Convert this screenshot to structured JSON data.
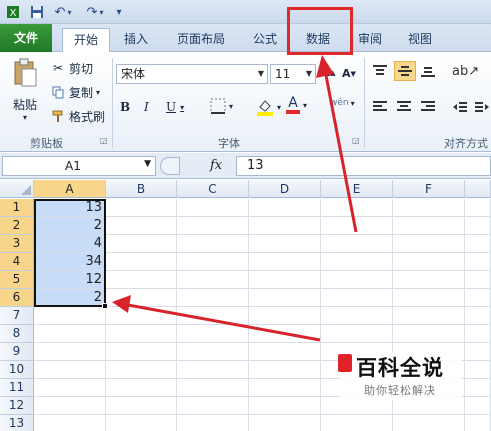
{
  "quick_access": {
    "save_icon": "save-icon",
    "undo_icon": "undo-icon",
    "redo_icon": "redo-icon"
  },
  "tabs": [
    {
      "label": "文件"
    },
    {
      "label": "开始"
    },
    {
      "label": "插入"
    },
    {
      "label": "页面布局"
    },
    {
      "label": "公式"
    },
    {
      "label": "数据"
    },
    {
      "label": "审阅"
    },
    {
      "label": "视图"
    }
  ],
  "clipboard": {
    "paste": "粘贴",
    "cut": "剪切",
    "copy": "复制",
    "format_painter": "格式刷",
    "group": "剪贴板"
  },
  "font": {
    "name": "宋体",
    "size": "11",
    "group": "字体",
    "bold": "B",
    "italic": "I",
    "underline": "U",
    "grow": "A",
    "shrink": "A",
    "phonetic": "wén"
  },
  "alignment": {
    "group": "对齐方式"
  },
  "formula_bar": {
    "name_box": "A1",
    "fx": "fx",
    "value": "13"
  },
  "columns": [
    "A",
    "B",
    "C",
    "D",
    "E",
    "F"
  ],
  "rows": [
    "1",
    "2",
    "3",
    "4",
    "5",
    "6",
    "7",
    "8",
    "9",
    "10",
    "11",
    "12",
    "13"
  ],
  "cells": [
    "13",
    "2",
    "4",
    "34",
    "12",
    "2"
  ],
  "watermark": {
    "title": "百科全说",
    "subtitle": "助你轻松解决"
  },
  "colors": {
    "file_tab": "#2a8c2e",
    "selection": "#c7dcf6",
    "highlight_box": "#e0282a",
    "arrow": "#d9232a"
  }
}
